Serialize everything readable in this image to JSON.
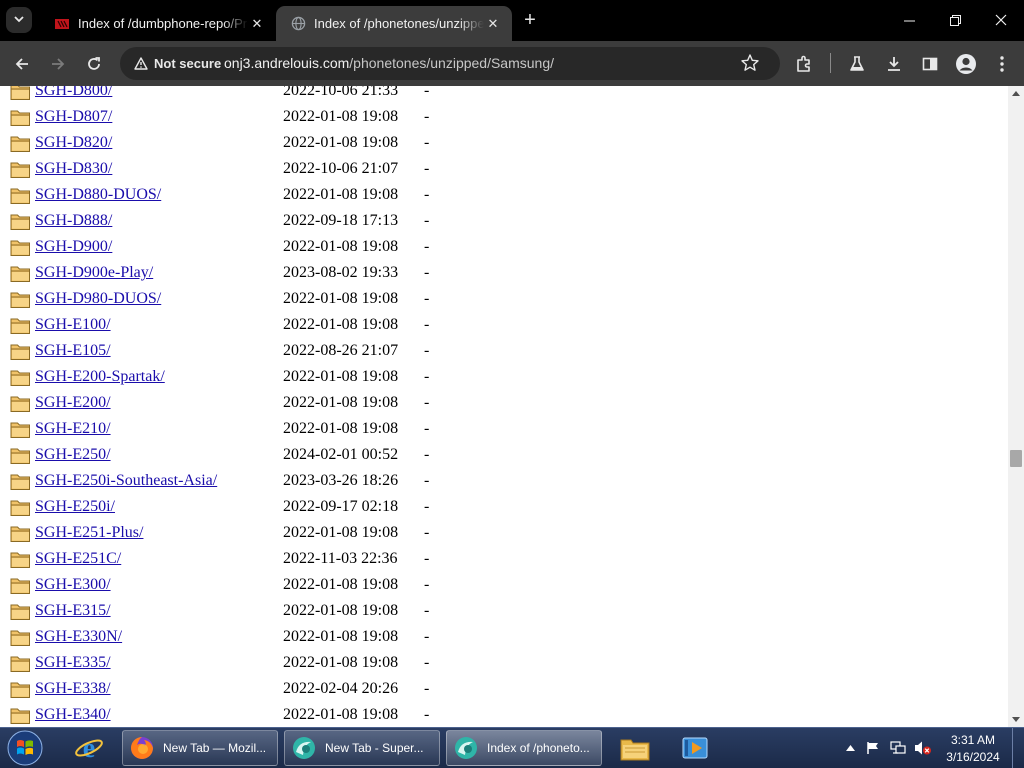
{
  "browser": {
    "tabs": [
      {
        "title": "Index of /dumbphone-repo/Pr",
        "favicon": "red-page-icon"
      },
      {
        "title": "Index of /phonetones/unzippe",
        "favicon": "globe-icon"
      }
    ],
    "security_label": "Not secure",
    "url_host": "onj3.andrelouis.com",
    "url_path": "/phonetones/unzipped/Samsung/"
  },
  "listing": {
    "rows": [
      {
        "name": "SGH-D800/",
        "date": "2022-10-06 21:33",
        "size": "-"
      },
      {
        "name": "SGH-D807/",
        "date": "2022-01-08 19:08",
        "size": "-"
      },
      {
        "name": "SGH-D820/",
        "date": "2022-01-08 19:08",
        "size": "-"
      },
      {
        "name": "SGH-D830/",
        "date": "2022-10-06 21:07",
        "size": "-"
      },
      {
        "name": "SGH-D880-DUOS/",
        "date": "2022-01-08 19:08",
        "size": "-"
      },
      {
        "name": "SGH-D888/",
        "date": "2022-09-18 17:13",
        "size": "-"
      },
      {
        "name": "SGH-D900/",
        "date": "2022-01-08 19:08",
        "size": "-"
      },
      {
        "name": "SGH-D900e-Play/",
        "date": "2023-08-02 19:33",
        "size": "-"
      },
      {
        "name": "SGH-D980-DUOS/",
        "date": "2022-01-08 19:08",
        "size": "-"
      },
      {
        "name": "SGH-E100/",
        "date": "2022-01-08 19:08",
        "size": "-"
      },
      {
        "name": "SGH-E105/",
        "date": "2022-08-26 21:07",
        "size": "-"
      },
      {
        "name": "SGH-E200-Spartak/",
        "date": "2022-01-08 19:08",
        "size": "-"
      },
      {
        "name": "SGH-E200/",
        "date": "2022-01-08 19:08",
        "size": "-"
      },
      {
        "name": "SGH-E210/",
        "date": "2022-01-08 19:08",
        "size": "-"
      },
      {
        "name": "SGH-E250/",
        "date": "2024-02-01 00:52",
        "size": "-"
      },
      {
        "name": "SGH-E250i-Southeast-Asia/",
        "date": "2023-03-26 18:26",
        "size": "-"
      },
      {
        "name": "SGH-E250i/",
        "date": "2022-09-17 02:18",
        "size": "-"
      },
      {
        "name": "SGH-E251-Plus/",
        "date": "2022-01-08 19:08",
        "size": "-"
      },
      {
        "name": "SGH-E251C/",
        "date": "2022-11-03 22:36",
        "size": "-"
      },
      {
        "name": "SGH-E300/",
        "date": "2022-01-08 19:08",
        "size": "-"
      },
      {
        "name": "SGH-E315/",
        "date": "2022-01-08 19:08",
        "size": "-"
      },
      {
        "name": "SGH-E330N/",
        "date": "2022-01-08 19:08",
        "size": "-"
      },
      {
        "name": "SGH-E335/",
        "date": "2022-01-08 19:08",
        "size": "-"
      },
      {
        "name": "SGH-E338/",
        "date": "2022-02-04 20:26",
        "size": "-"
      },
      {
        "name": "SGH-E340/",
        "date": "2022-01-08 19:08",
        "size": "-"
      }
    ]
  },
  "taskbar": {
    "tasks": [
      {
        "label": "New Tab — Mozil...",
        "icon": "firefox-icon"
      },
      {
        "label": "New Tab - Super...",
        "icon": "supermium-icon"
      },
      {
        "label": "Index of /phoneto...",
        "icon": "supermium-icon"
      }
    ],
    "time": "3:31 AM",
    "date": "3/16/2024"
  }
}
